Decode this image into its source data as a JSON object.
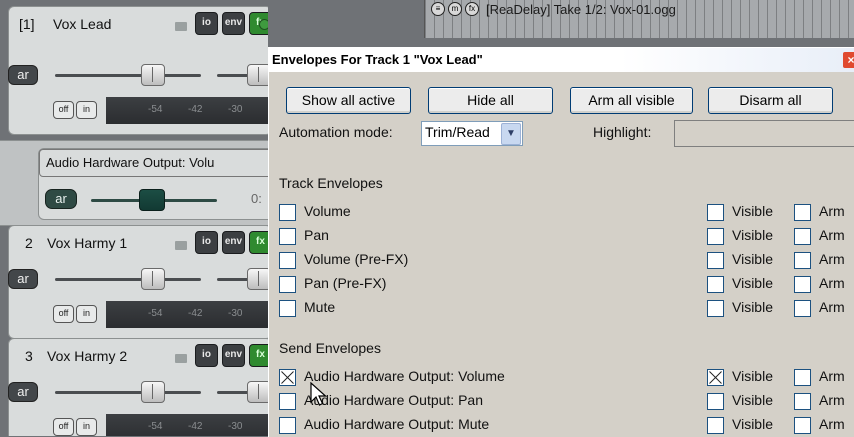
{
  "tracks": [
    {
      "number": "[1]",
      "name": "Vox Lead",
      "meter_ticks": [
        "-54",
        "-42",
        "-30"
      ]
    },
    {
      "number": "2",
      "name": "Vox Harmy 1",
      "meter_ticks": [
        "-54",
        "-42",
        "-30"
      ]
    },
    {
      "number": "3",
      "name": "Vox Harmy 2",
      "meter_ticks": [
        "-54",
        "-42",
        "-30"
      ]
    }
  ],
  "track_buttons": {
    "io": "io",
    "env": "env",
    "fx": "fx",
    "ar": "ar",
    "off": "off",
    "in": "in"
  },
  "send": {
    "label": "Audio Hardware Output: Volu",
    "value_fragment": "0:"
  },
  "item": {
    "title": "[ReaDelay] Take 1/2: Vox-01.ogg"
  },
  "dialog": {
    "title": "Envelopes For Track 1 \"Vox Lead\"",
    "close_glyph": "×",
    "buttons": [
      "Show all active",
      "Hide all",
      "Arm all visible",
      "Disarm all"
    ],
    "automation_label": "Automation mode:",
    "automation_value": "Trim/Read",
    "highlight_label": "Highlight:",
    "track_section": "Track Envelopes",
    "send_section": "Send Envelopes",
    "visible_label": "Visible",
    "arm_label": "Arm",
    "track_envelopes": [
      {
        "name": "Volume",
        "visible": false,
        "arm": false
      },
      {
        "name": "Pan",
        "visible": false,
        "arm": false
      },
      {
        "name": "Volume (Pre-FX)",
        "visible": false,
        "arm": false
      },
      {
        "name": "Pan (Pre-FX)",
        "visible": false,
        "arm": false
      },
      {
        "name": "Mute",
        "visible": false,
        "arm": false
      }
    ],
    "send_envelopes": [
      {
        "name": "Audio Hardware Output: Volume",
        "enabled": true,
        "visible": true,
        "arm": false
      },
      {
        "name": "Audio Hardware Output: Pan",
        "enabled": false,
        "visible": false,
        "arm": false
      },
      {
        "name": "Audio Hardware Output: Mute",
        "enabled": false,
        "visible": false,
        "arm": false
      }
    ]
  }
}
